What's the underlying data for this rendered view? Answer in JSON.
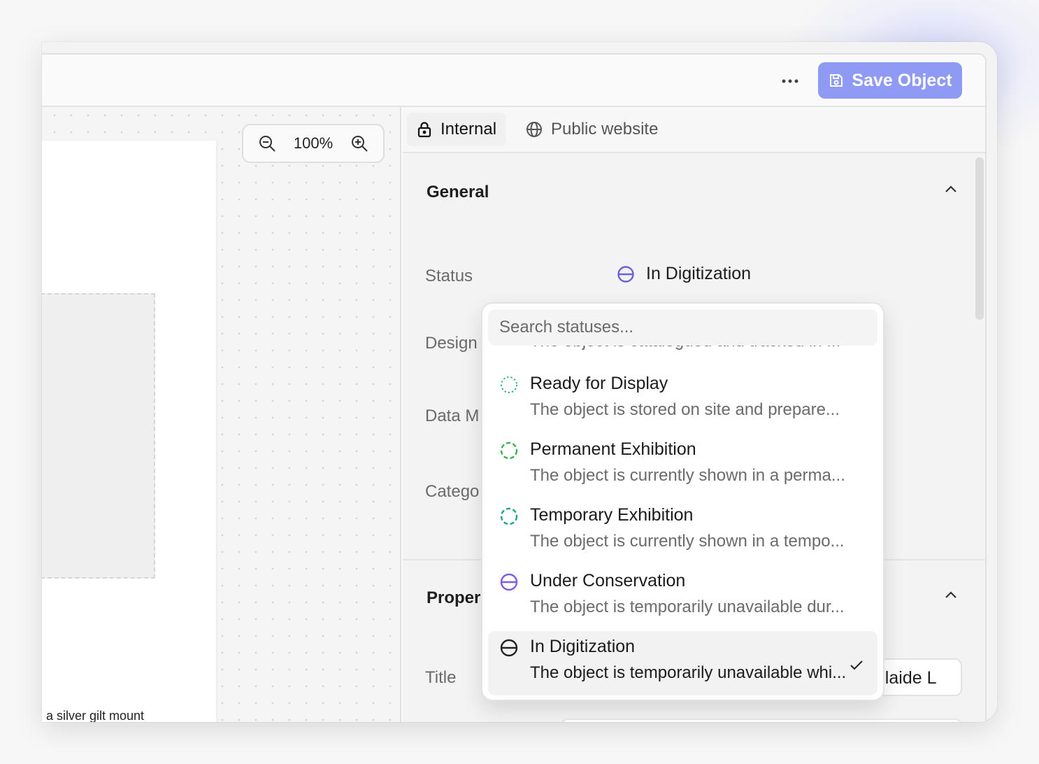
{
  "toolbar": {
    "save_label": "Save Object",
    "more_icon": "more-horizontal-icon",
    "save_icon": "floppy-disk-icon"
  },
  "canvas": {
    "zoom_level": "100%",
    "caption": "a silver gilt mount"
  },
  "tabs": [
    {
      "label": "Internal",
      "icon": "lock-icon",
      "active": true
    },
    {
      "label": "Public website",
      "icon": "globe-icon",
      "active": false
    }
  ],
  "general": {
    "title": "General",
    "fields": {
      "status_label": "Status",
      "status_value": "In Digitization",
      "design_label": "Design",
      "data_label": "Data M",
      "category_label": "Catego"
    }
  },
  "properties": {
    "title": "Proper",
    "title_label": "Title",
    "title_value": "delaide L"
  },
  "status_dropdown": {
    "search_placeholder": "Search statuses...",
    "partial_desc": "The object is catalogued and tracked in ...",
    "items": [
      {
        "name": "Ready for Display",
        "desc": "The object is stored on site and prepare...",
        "color": "#22b28a"
      },
      {
        "name": "Permanent Exhibition",
        "desc": "The object is currently shown in a perma...",
        "color": "#3bb54a"
      },
      {
        "name": "Temporary Exhibition",
        "desc": "The object is currently shown in a tempo...",
        "color": "#1fa68a"
      },
      {
        "name": "Under Conservation",
        "desc": "The object is temporarily unavailable dur...",
        "color": "#7c5ce0"
      },
      {
        "name": "In Digitization",
        "desc": "The object is temporarily unavailable whi...",
        "color": "#222222",
        "selected": true
      }
    ]
  },
  "colors": {
    "accent": "#8f9af5",
    "status_in_digitization": "#6a60e0"
  }
}
